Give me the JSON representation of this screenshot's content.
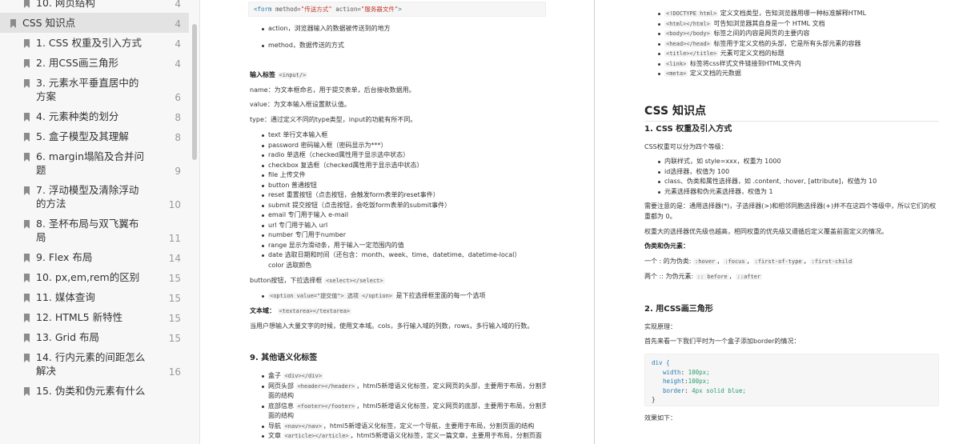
{
  "sidebar": {
    "items": [
      {
        "label": "10. 网页结构",
        "page": "4",
        "level": 2,
        "active": false
      },
      {
        "label": "CSS 知识点",
        "page": "4",
        "level": 1,
        "active": true
      },
      {
        "label": "1. CSS 权重及引入方式",
        "page": "4",
        "level": 2,
        "active": false
      },
      {
        "label": "2. 用CSS画三角形",
        "page": "4",
        "level": 2,
        "active": false
      },
      {
        "label": "3. 元素水平垂直居中的方案",
        "page": "6",
        "level": 2,
        "active": false
      },
      {
        "label": "4. 元素种类的划分",
        "page": "8",
        "level": 2,
        "active": false
      },
      {
        "label": "5. 盒子模型及其理解",
        "page": "8",
        "level": 2,
        "active": false
      },
      {
        "label": "6. margin塌陷及合并问题",
        "page": "9",
        "level": 2,
        "active": false
      },
      {
        "label": "7. 浮动模型及清除浮动的方法",
        "page": "10",
        "level": 2,
        "active": false
      },
      {
        "label": "8. 圣杯布局与双飞翼布局",
        "page": "11",
        "level": 2,
        "active": false
      },
      {
        "label": "9. Flex 布局",
        "page": "14",
        "level": 2,
        "active": false
      },
      {
        "label": "10. px,em,rem的区别",
        "page": "15",
        "level": 2,
        "active": false
      },
      {
        "label": "11. 媒体查询",
        "page": "15",
        "level": 2,
        "active": false
      },
      {
        "label": "12. HTML5 新特性",
        "page": "15",
        "level": 2,
        "active": false
      },
      {
        "label": "13. Grid 布局",
        "page": "15",
        "level": 2,
        "active": false
      },
      {
        "label": "14. 行内元素的间距怎么解决",
        "page": "16",
        "level": 2,
        "active": false
      },
      {
        "label": "15. 伪类和伪元素有什么",
        "page": "",
        "level": 2,
        "active": false
      }
    ]
  },
  "left_page": {
    "form_code": {
      "tag": "<form ",
      "attr1": "method=",
      "val1": "\"传送方式\"",
      "attr2": " action=",
      "val2": "\"服务器文件\"",
      "end": ">"
    },
    "form_bullets": [
      "action，浏览器输入的数据被传送到的地方",
      "method，数据传送的方式"
    ],
    "input_heading": "输入标签",
    "input_code": "<input/>",
    "name_line": "name：为文本框命名，用于提交表单，后台接收数据用。",
    "value_line": "value：为文本输入框设置默认值。",
    "type_line": "type：通过定义不同的type类型，input的功能有所不同。",
    "type_bullets": [
      "text 单行文本输入框",
      "password 密码输入框（密码显示为***）",
      "radio 单选框（checked属性用于显示选中状态）",
      "checkbox 复选框（checked属性用于显示选中状态）",
      "file 上传文件",
      "button 普通按钮",
      "reset 重置按钮（点击按钮，会触发form表单的reset事件）",
      "submit 提交按钮（点击按钮，会吃饭form表单的submit事件）",
      "email 专门用于输入 e-mail",
      "url 专门用于输入 url",
      "number 专门用于number",
      "range 显示为滑动条，用于输入一定范围内的值",
      "date 选取日期和时间（还包含：month、week、time、datetime、datetime-local）",
      "color 选取颜色"
    ],
    "button_line_pre": "button按钮，下拉选择框",
    "button_line_code": "<select></select>",
    "option_code": "<option value=\"提交值\"> 选项 </option>",
    "option_text": "是下拉选择框里面的每一个选项",
    "textarea_label": "文本域：",
    "textarea_code": "<textarea></textarea>",
    "textarea_desc": "当用户想输入大量文字的时候，使用文本域。cols，多行输入域的列数，rows，多行输入域的行数。",
    "semantic_heading": "9. 其他语义化标签",
    "semantic_bullets": [
      {
        "pre": "盒子",
        "code": "<div></div>",
        "post": ""
      },
      {
        "pre": "网页头部",
        "code": "<header></header>",
        "post": "，html5新增语义化标签，定义网页的头部，主要用于布局，分割页面的结构"
      },
      {
        "pre": "底部信息",
        "code": "<footer></footer>",
        "post": "，html5新增语义化标签，定义网页的底部，主要用于布局，分割页面的结构"
      },
      {
        "pre": "导航",
        "code": "<nav></nav>",
        "post": "，html5新增语义化标签，定义一个导航，主要用于布局，分割页面的结构"
      },
      {
        "pre": "文章",
        "code": "<article></article>",
        "post": "，html5新增语义化标签，定义一篇文章，主要用于布局，分割页面"
      }
    ]
  },
  "right_page": {
    "top_bullets": [
      {
        "code": "<!DOCTYPE html>",
        "text": " 定义文档类型，告知浏览器用哪一种标准解释HTML"
      },
      {
        "code": "<html></html>",
        "text": " 可告知浏览器其自身是一个 HTML 文档"
      },
      {
        "code": "<body></body>",
        "text": " 标签之间的内容是网页的主要内容"
      },
      {
        "code": "<head></head>",
        "text": " 标签用于定义文档的头部，它是所有头部元素的容器"
      },
      {
        "code": "<title></title>",
        "text": " 元素可定义文档的标题"
      },
      {
        "code": "<link>",
        "text": " 标签将css样式文件链接到HTML文件内"
      },
      {
        "code": "<meta>",
        "text": " 定义文档的元数据"
      }
    ],
    "h1": "CSS 知识点",
    "h2_weight": "1. CSS 权重及引入方式",
    "weight_intro": "CSS权重可以分为四个等级：",
    "weight_bullets": [
      "内联样式，如 style=xxx，权重为 1000",
      "id选择器，权值为 100",
      "class、伪类和属性选择器，如 .content, :hover, [attribute]，权值为 10",
      "元素选择器和伪元素选择器，权值为 1"
    ],
    "note1": "需要注意的是：通用选择器(*)，子选择器(>)和相邻同胞选择器(+)并不在这四个等级中，所以它们的权重都为 0。",
    "note2": "权重大的选择器优先级也越高，相同权重的优先级又遵循后定义覆盖前面定义的情况。",
    "pseudo_heading": "伪类和伪元素：",
    "pseudo_class_pre": "一个 : 的为伪类:",
    "pseudo_class_codes": [
      ":hover",
      ":focus",
      ":first-of-type",
      ":first-child"
    ],
    "pseudo_el_pre": "两个 :: 为伪元素:",
    "pseudo_el_codes": [
      ":: before",
      "::after"
    ],
    "h2_triangle": "2. 用CSS画三角形",
    "impl_label": "实现原理：",
    "impl_desc": "首先来看一下我们平时为一个盒子添加border的情况：",
    "code_block": {
      "selector": "div {",
      "lines": [
        {
          "prop": "width",
          "value": "100px;"
        },
        {
          "prop": "height",
          "value": "100px;"
        },
        {
          "prop": "border",
          "value": "4px solid blue;"
        }
      ],
      "close": "}"
    },
    "effect": "效果如下："
  }
}
